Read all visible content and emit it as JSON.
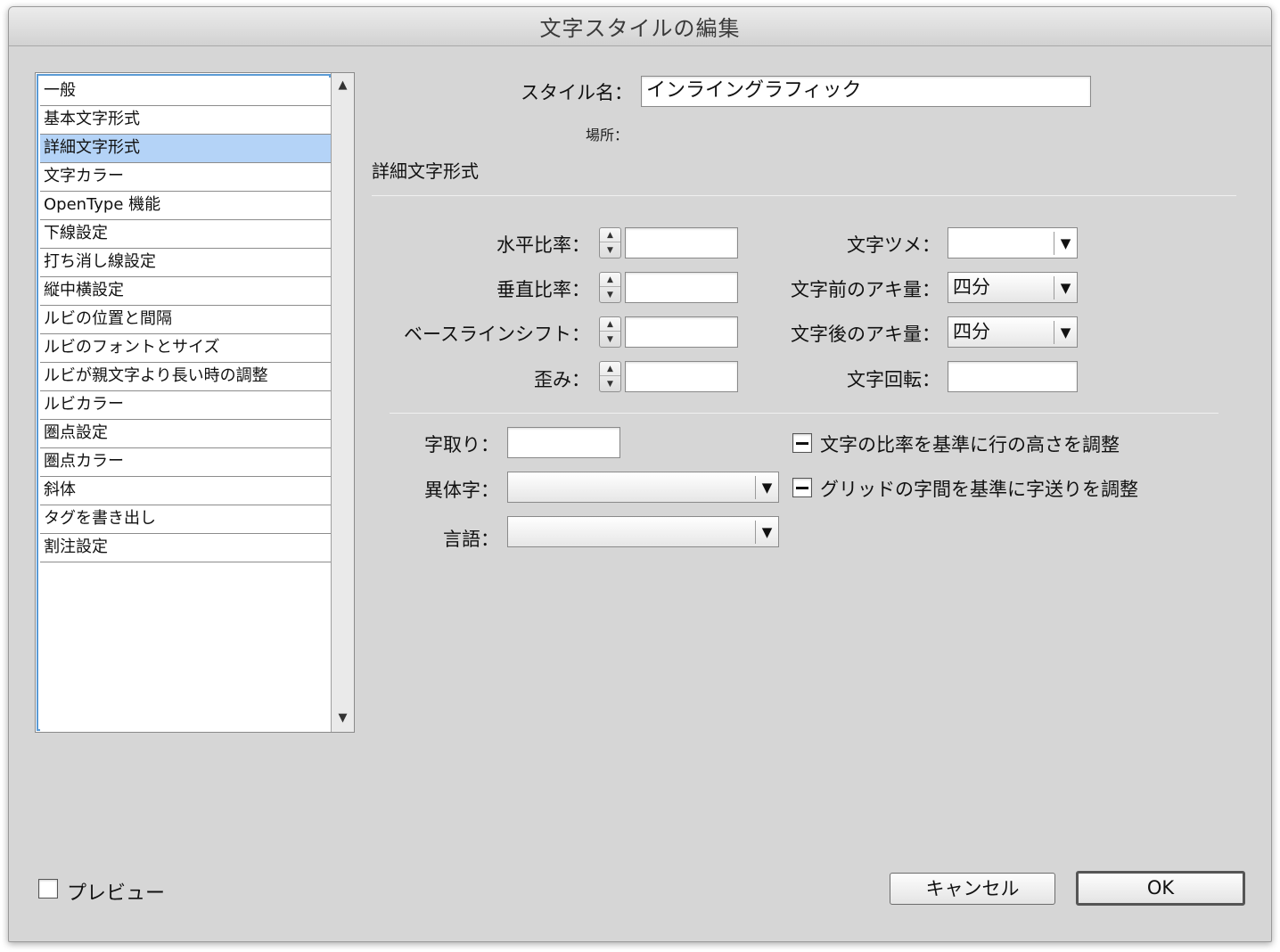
{
  "window": {
    "title": "文字スタイルの編集"
  },
  "categories": [
    "一般",
    "基本文字形式",
    "詳細文字形式",
    "文字カラー",
    "OpenType 機能",
    "下線設定",
    "打ち消し線設定",
    "縦中横設定",
    "ルビの位置と間隔",
    "ルビのフォントとサイズ",
    "ルビが親文字より長い時の調整",
    "ルビカラー",
    "圏点設定",
    "圏点カラー",
    "斜体",
    "タグを書き出し",
    "割注設定"
  ],
  "selected_category": "詳細文字形式",
  "style_name": {
    "label": "スタイル名：",
    "value": "インライングラフィック"
  },
  "location": {
    "label": "場所："
  },
  "section_title": "詳細文字形式",
  "left_fields": {
    "horizontal_scale": {
      "label": "水平比率：",
      "value": ""
    },
    "vertical_scale": {
      "label": "垂直比率：",
      "value": ""
    },
    "baseline_shift": {
      "label": "ベースラインシフト：",
      "value": ""
    },
    "skew": {
      "label": "歪み：",
      "value": ""
    }
  },
  "right_fields": {
    "tsume": {
      "label": "文字ツメ：",
      "value": ""
    },
    "aki_before": {
      "label": "文字前のアキ量：",
      "value": "四分"
    },
    "aki_after": {
      "label": "文字後のアキ量：",
      "value": "四分"
    },
    "rotation": {
      "label": "文字回転：",
      "value": ""
    }
  },
  "lower": {
    "mojitori": {
      "label": "字取り：",
      "value": ""
    },
    "variant": {
      "label": "異体字：",
      "value": ""
    },
    "language": {
      "label": "言語：",
      "value": ""
    },
    "check_ratio": {
      "label": "文字の比率を基準に行の高さを調整",
      "state": "mixed"
    },
    "check_grid": {
      "label": "グリッドの字間を基準に字送りを調整",
      "state": "mixed"
    }
  },
  "preview": {
    "label": "プレビュー",
    "checked": false
  },
  "buttons": {
    "cancel": "キャンセル",
    "ok": "OK"
  },
  "icons": {
    "scroll_up": "▲",
    "scroll_down": "▼",
    "stepper_up": "▲",
    "stepper_down": "▼",
    "dropdown": "▼"
  }
}
